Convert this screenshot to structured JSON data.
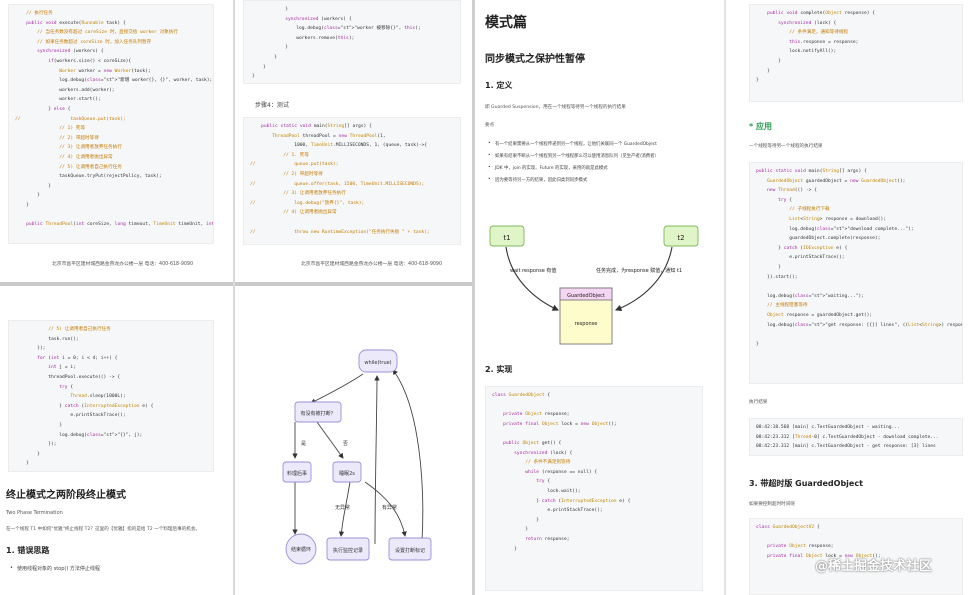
{
  "p1": {
    "code": [
      "    // 执行任务",
      "    public void execute(Runnable task) {",
      "        // 当任务数没有超过 coreSize 时，直接交给 worker 对象执行",
      "        // 如果任务数超过 coreSize 时，加入任务队列暂存",
      "        synchronized (workers) {",
      "            if(workers.size() < coreSize){",
      "                Worker worker = new Worker(task);",
      "                log.debug(\"新增 worker{}, {}\", worker, task);",
      "                workers.add(worker);",
      "                worker.start();",
      "            } else {",
      "//                  taskQueue.put(task);",
      "                // 1) 死等",
      "                // 2) 带超时等待",
      "                // 3) 让调用者放弃任务执行",
      "                // 4) 让调用者抛出异常",
      "                // 5) 让调用者自己执行任务",
      "                taskQueue.tryPut(rejectPolicy, task);",
      "            }",
      "        }",
      "    }",
      "",
      "    public ThreadPool(int coreSize, long timeout, TimeUnit timeUnit, int queueCapcity,"
    ],
    "footer": "北京市昌平区建材城西路金燕龙办公楼一层    电话：400-618-9090"
  },
  "p2": {
    "code_top": [
      "            }",
      "            synchronized (workers) {",
      "                log.debug(\"worker 被移除{}\", this);",
      "                workers.remove(this);",
      "            }",
      "        }",
      "    }",
      "}"
    ],
    "step": "步骤4：测试",
    "code_main": [
      "    public static void main(String[] args) {",
      "        ThreadPool threadPool = new ThreadPool(1,",
      "                1000, TimeUnit.MILLISECONDS, 1, (queue, task)->{",
      "            // 1. 死等",
      "//              queue.put(task);",
      "            // 2) 带超时等待",
      "//              queue.offer(task, 1500, TimeUnit.MILLISECONDS);",
      "            // 3) 让调用者放弃任务执行",
      "//              log.debug(\"放弃{}\", task);",
      "            // 4) 让调用者抛出异常",
      "",
      "//              throw new RuntimeException(\"任务执行失败 \" + task);"
    ],
    "footer": "北京市昌平区建材城西路金燕龙办公楼一层    电话：400-618-9090"
  },
  "p3": {
    "code": [
      "            // 5) 让调用者自己执行任务",
      "            task.run();",
      "        });",
      "        for (int i = 0; i < 4; i++) {",
      "            int j = i;",
      "            threadPool.execute(() -> {",
      "                try {",
      "                    Thread.sleep(1000L);",
      "                } catch (InterruptedException e) {",
      "                    e.printStackTrace();",
      "                }",
      "                log.debug(\"{}\", j);",
      "            });",
      "        }",
      "    }"
    ],
    "title": "终止模式之两阶段终止模式",
    "subtitle": "Two Phase Termination",
    "desc": "在一个线程 T1 中如何\"优雅\"终止线程 T2？这里的【优雅】指的是给 T2 一个料理后事的机会。",
    "h2": "1. 错误思路",
    "bullet": "使用线程对象的 stop() 方法停止线程"
  },
  "p4": {
    "nodes": {
      "while": "while(true)",
      "interrupted": "有没有被打断？",
      "cleanup": "料理后事",
      "sleep": "睡眠2s",
      "end": "结束循环",
      "record": "执行监控记录",
      "setflag": "设置打断标记"
    },
    "edges": {
      "yes": "是",
      "no": "否",
      "noexc": "无异常",
      "exc": "有异常"
    }
  },
  "p5": {
    "title": "模式篇",
    "h2": "同步模式之保护性暂停",
    "h3": "1. 定义",
    "def": "即 Guarded Suspension，用在一个线程等待另一个线程的执行结果",
    "points_label": "要点",
    "bullets": [
      "有一个结果需要从一个线程传递到另一个线程，让他们关联同一个 GuardedObject",
      "如果有结果不断从一个线程到另一个线程那么可以使用消息队列（见生产者/消费者）",
      "JDK 中，join 的实现、Future 的实现，采用的就是此模式",
      "因为要等待另一方的结果，因此归类到同步模式"
    ],
    "diagram": {
      "t1": "t1",
      "t2": "t2",
      "guarded": "GuardedObject",
      "response": "response",
      "wait": "wait response 有值",
      "complete": "任务完成，为response 赋值，通知 t1"
    },
    "h3b": "2. 实现",
    "code": [
      "class GuardedObject {",
      "",
      "    private Object response;",
      "    private final Object lock = new Object();",
      "",
      "    public Object get() {",
      "        synchronized (lock) {",
      "            // 条件不满足则等待",
      "            while (response == null) {",
      "                try {",
      "                    lock.wait();",
      "                } catch (InterruptedException e) {",
      "                    e.printStackTrace();",
      "                }",
      "            }",
      "            return response;",
      "        }"
    ]
  },
  "p6": {
    "code_top": [
      "    public void complete(Object response) {",
      "        synchronized (lock) {",
      "            // 条件满足，通知等待线程",
      "            this.response = response;",
      "            lock.notifyAll();",
      "        }",
      "    }",
      "}"
    ],
    "app_title": "* 应用",
    "app_desc": "一个线程等待另一个线程的执行结果",
    "code_app": [
      "public static void main(String[] args) {",
      "    GuardedObject guardedObject = new GuardedObject();",
      "    new Thread(() -> {",
      "        try {",
      "            // 子线程执行下载",
      "            List<String> response = download();",
      "            log.debug(\"download complete...\");",
      "            guardedObject.complete(response);",
      "        } catch (IOException e) {",
      "            e.printStackTrace();",
      "        }",
      "    }).start();",
      "",
      "    log.debug(\"waiting...\");",
      "    // 主线程阻塞等待",
      "    Object response = guardedObject.get();",
      "    log.debug(\"get response: [{}] lines\", ((List<String>) response).size());",
      "",
      "}"
    ],
    "result_label": "执行结果",
    "result": [
      "08:42:18.568 [main] c.TestGuardedObject - waiting...",
      "08:42:23.312 [Thread-0] c.TestGuardedObject - download complete...",
      "08:42:23.312 [main] c.TestGuardedObject - get response: [3] lines"
    ],
    "h3": "3. 带超时版 GuardedObject",
    "h3_desc": "如果要控制超时时间呢",
    "code_bottom": [
      "class GuardedObjectV2 {",
      "",
      "    private Object response;",
      "    private final Object lock = new Object();"
    ]
  },
  "watermark": "@稀土掘金技术社区"
}
